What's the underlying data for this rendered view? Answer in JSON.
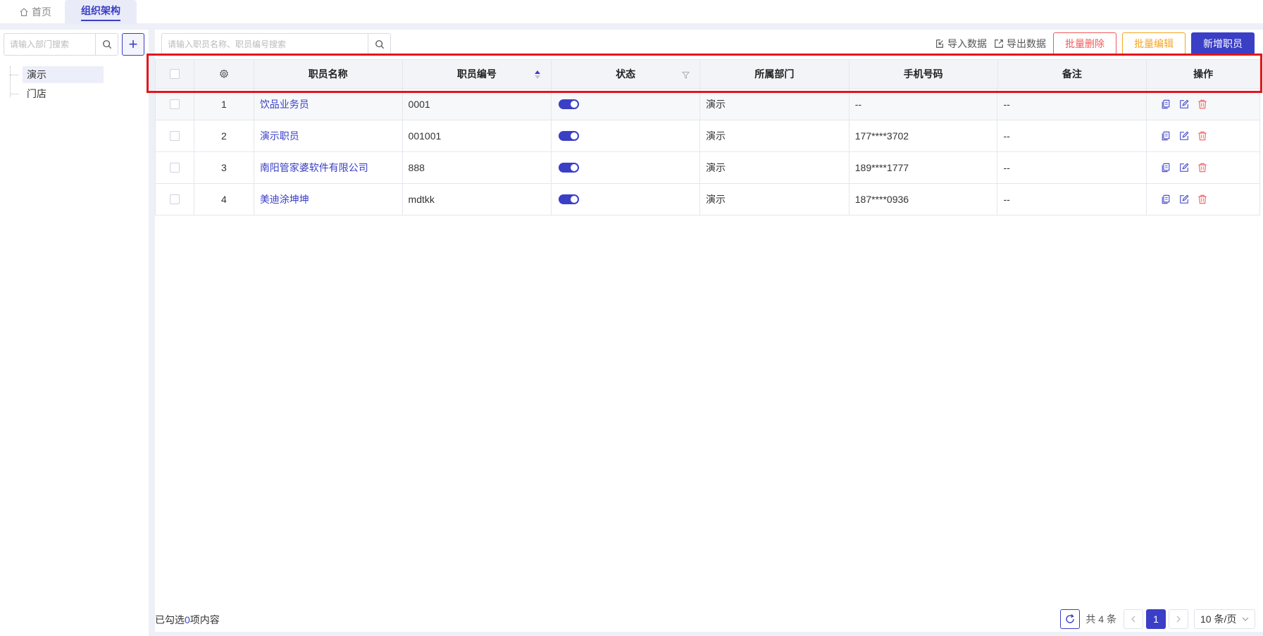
{
  "tabs": {
    "home": "首页",
    "active": "组织架构"
  },
  "left": {
    "search_placeholder": "请输入部门搜索",
    "add_label": "+",
    "tree": [
      "演示",
      "门店"
    ]
  },
  "toolbar": {
    "search_placeholder": "请输入职员名称、职员编号搜索",
    "import": "导入数据",
    "export": "导出数据",
    "batch_delete": "批量删除",
    "batch_edit": "批量编辑",
    "add_staff": "新增职员"
  },
  "table": {
    "headers": {
      "name": "职员名称",
      "code": "职员编号",
      "status": "状态",
      "dept": "所属部门",
      "phone": "手机号码",
      "remark": "备注",
      "op": "操作"
    },
    "rows": [
      {
        "idx": "1",
        "name": "饮品业务员",
        "code": "0001",
        "dept": "演示",
        "phone": "--",
        "remark": "--"
      },
      {
        "idx": "2",
        "name": "演示职员",
        "code": "001001",
        "dept": "演示",
        "phone": "177****3702",
        "remark": "--"
      },
      {
        "idx": "3",
        "name": "南阳管家婆软件有限公司",
        "code": "888",
        "dept": "演示",
        "phone": "189****1777",
        "remark": "--"
      },
      {
        "idx": "4",
        "name": "美迪涂坤坤",
        "code": "mdtkk",
        "dept": "演示",
        "phone": "187****0936",
        "remark": "--"
      }
    ]
  },
  "footer": {
    "selected_prefix": "已勾选",
    "selected_count": "0",
    "selected_suffix": "项内容",
    "total": "共 4 条",
    "current_page": "1",
    "page_size": "10 条/页"
  },
  "colors": {
    "primary": "#3a3fc6",
    "danger": "#f25a5a",
    "warning": "#f5a623",
    "highlight": "#e3161b"
  }
}
